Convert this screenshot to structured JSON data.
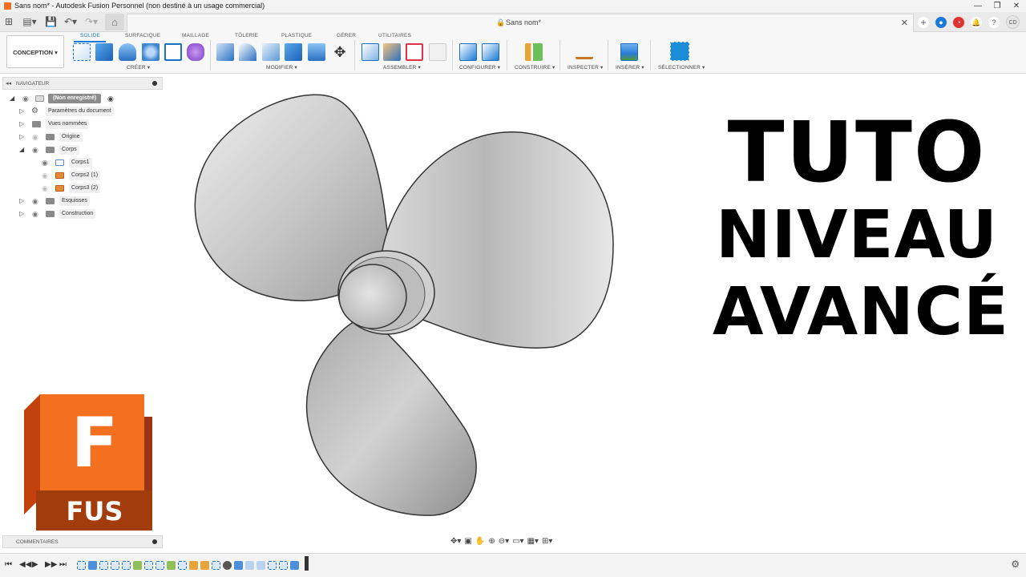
{
  "titlebar": {
    "title": "Sans nom* - Autodesk Fusion Personnel (non destiné à un usage commercial)",
    "minimize": "—",
    "restore": "❐",
    "close": "✕"
  },
  "tabbar": {
    "doc_name": "Sans nom*",
    "lock_icon": "🔒",
    "close_icon": "✕",
    "avatar": "CD"
  },
  "toolbar": {
    "workspace": "CONCEPTION ▾",
    "tabs": [
      "SOLIDE",
      "SURFACIQUE",
      "MAILLAGE",
      "TÔLERIE",
      "PLASTIQUE",
      "GÉRER",
      "UTILITAIRES"
    ],
    "groups": [
      "CRÉER ▾",
      "MODIFIER ▾",
      "ASSEMBLER ▾",
      "CONFIGURER ▾",
      "CONSTRUIRE ▾",
      "INSPECTER ▾",
      "INSÉRER ▾",
      "SÉLECTIONNER ▾"
    ]
  },
  "navigator": {
    "title": "NAVIGATEUR",
    "root": "(Non enregistré)",
    "items": [
      {
        "label": "Paramètres du document"
      },
      {
        "label": "Vues nommées"
      },
      {
        "label": "Origine"
      },
      {
        "label": "Corps"
      },
      {
        "label": "Corps1"
      },
      {
        "label": "Corps2 (1)"
      },
      {
        "label": "Corps3 (2)"
      },
      {
        "label": "Esquisses"
      },
      {
        "label": "Construction"
      }
    ]
  },
  "overlay": {
    "line1": "TUTO",
    "line2": "NIVEAU",
    "line3": "AVANCÉ",
    "logo_letter": "F",
    "logo_text": "FUS"
  },
  "comments": {
    "title": "COMMENTAIRES"
  },
  "colors": {
    "accent": "#1a7ad6",
    "fusion_orange": "#f37021",
    "fusion_dark": "#c2410c"
  }
}
